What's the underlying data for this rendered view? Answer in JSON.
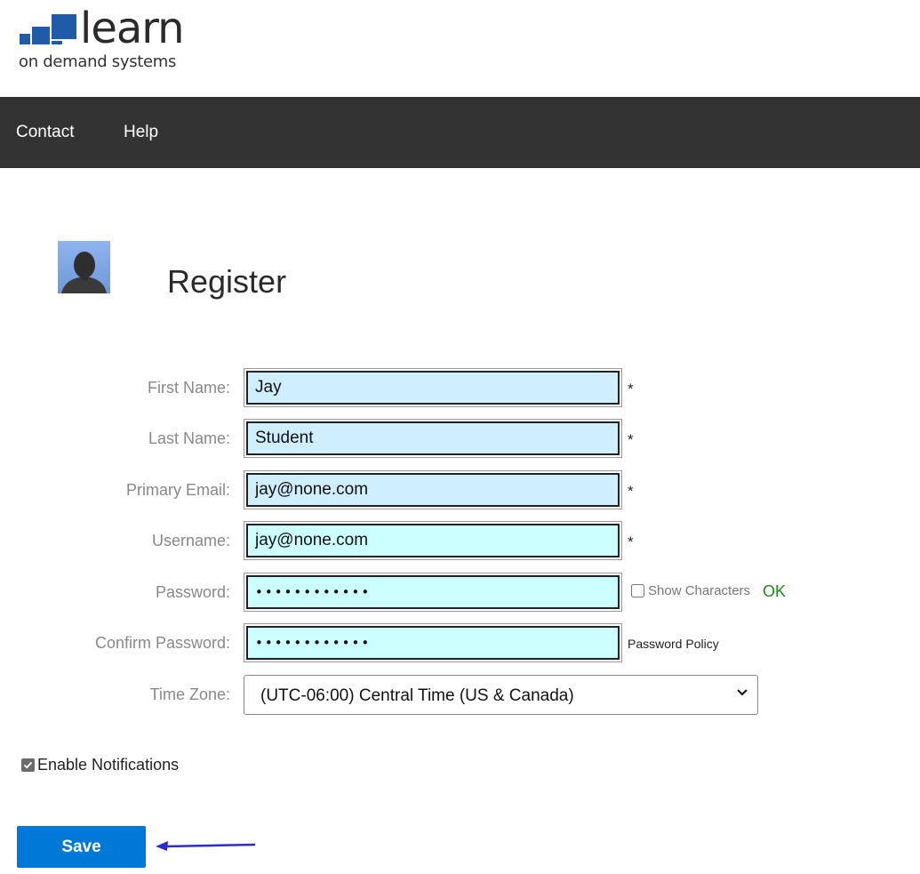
{
  "logo": {
    "word": "learn",
    "tagline": "on demand systems",
    "brand_color": "#1f5ba8"
  },
  "nav": {
    "items": [
      {
        "label": "Contact"
      },
      {
        "label": "Help"
      }
    ],
    "background": "#333333"
  },
  "page": {
    "title": "Register"
  },
  "form": {
    "first_name": {
      "label": "First Name:",
      "value": "Jay",
      "required": "*"
    },
    "last_name": {
      "label": "Last Name:",
      "value": "Student",
      "required": "*"
    },
    "primary_email": {
      "label": "Primary Email:",
      "value": "jay@none.com",
      "required": "*"
    },
    "username": {
      "label": "Username:",
      "value": "jay@none.com",
      "required": "*"
    },
    "password": {
      "label": "Password:",
      "value": "••••••••••••",
      "show_characters": "Show Characters",
      "status": "OK"
    },
    "confirm_password": {
      "label": "Confirm Password:",
      "value": "••••••••••••",
      "policy_link": "Password Policy"
    },
    "time_zone": {
      "label": "Time Zone:",
      "value": "(UTC-06:00) Central Time (US & Canada)"
    },
    "enable_notifications": {
      "label": "Enable Notifications",
      "checked": true
    }
  },
  "actions": {
    "save_label": "Save",
    "save_color": "#0078d7",
    "arrow_color": "#2b2bd6"
  }
}
